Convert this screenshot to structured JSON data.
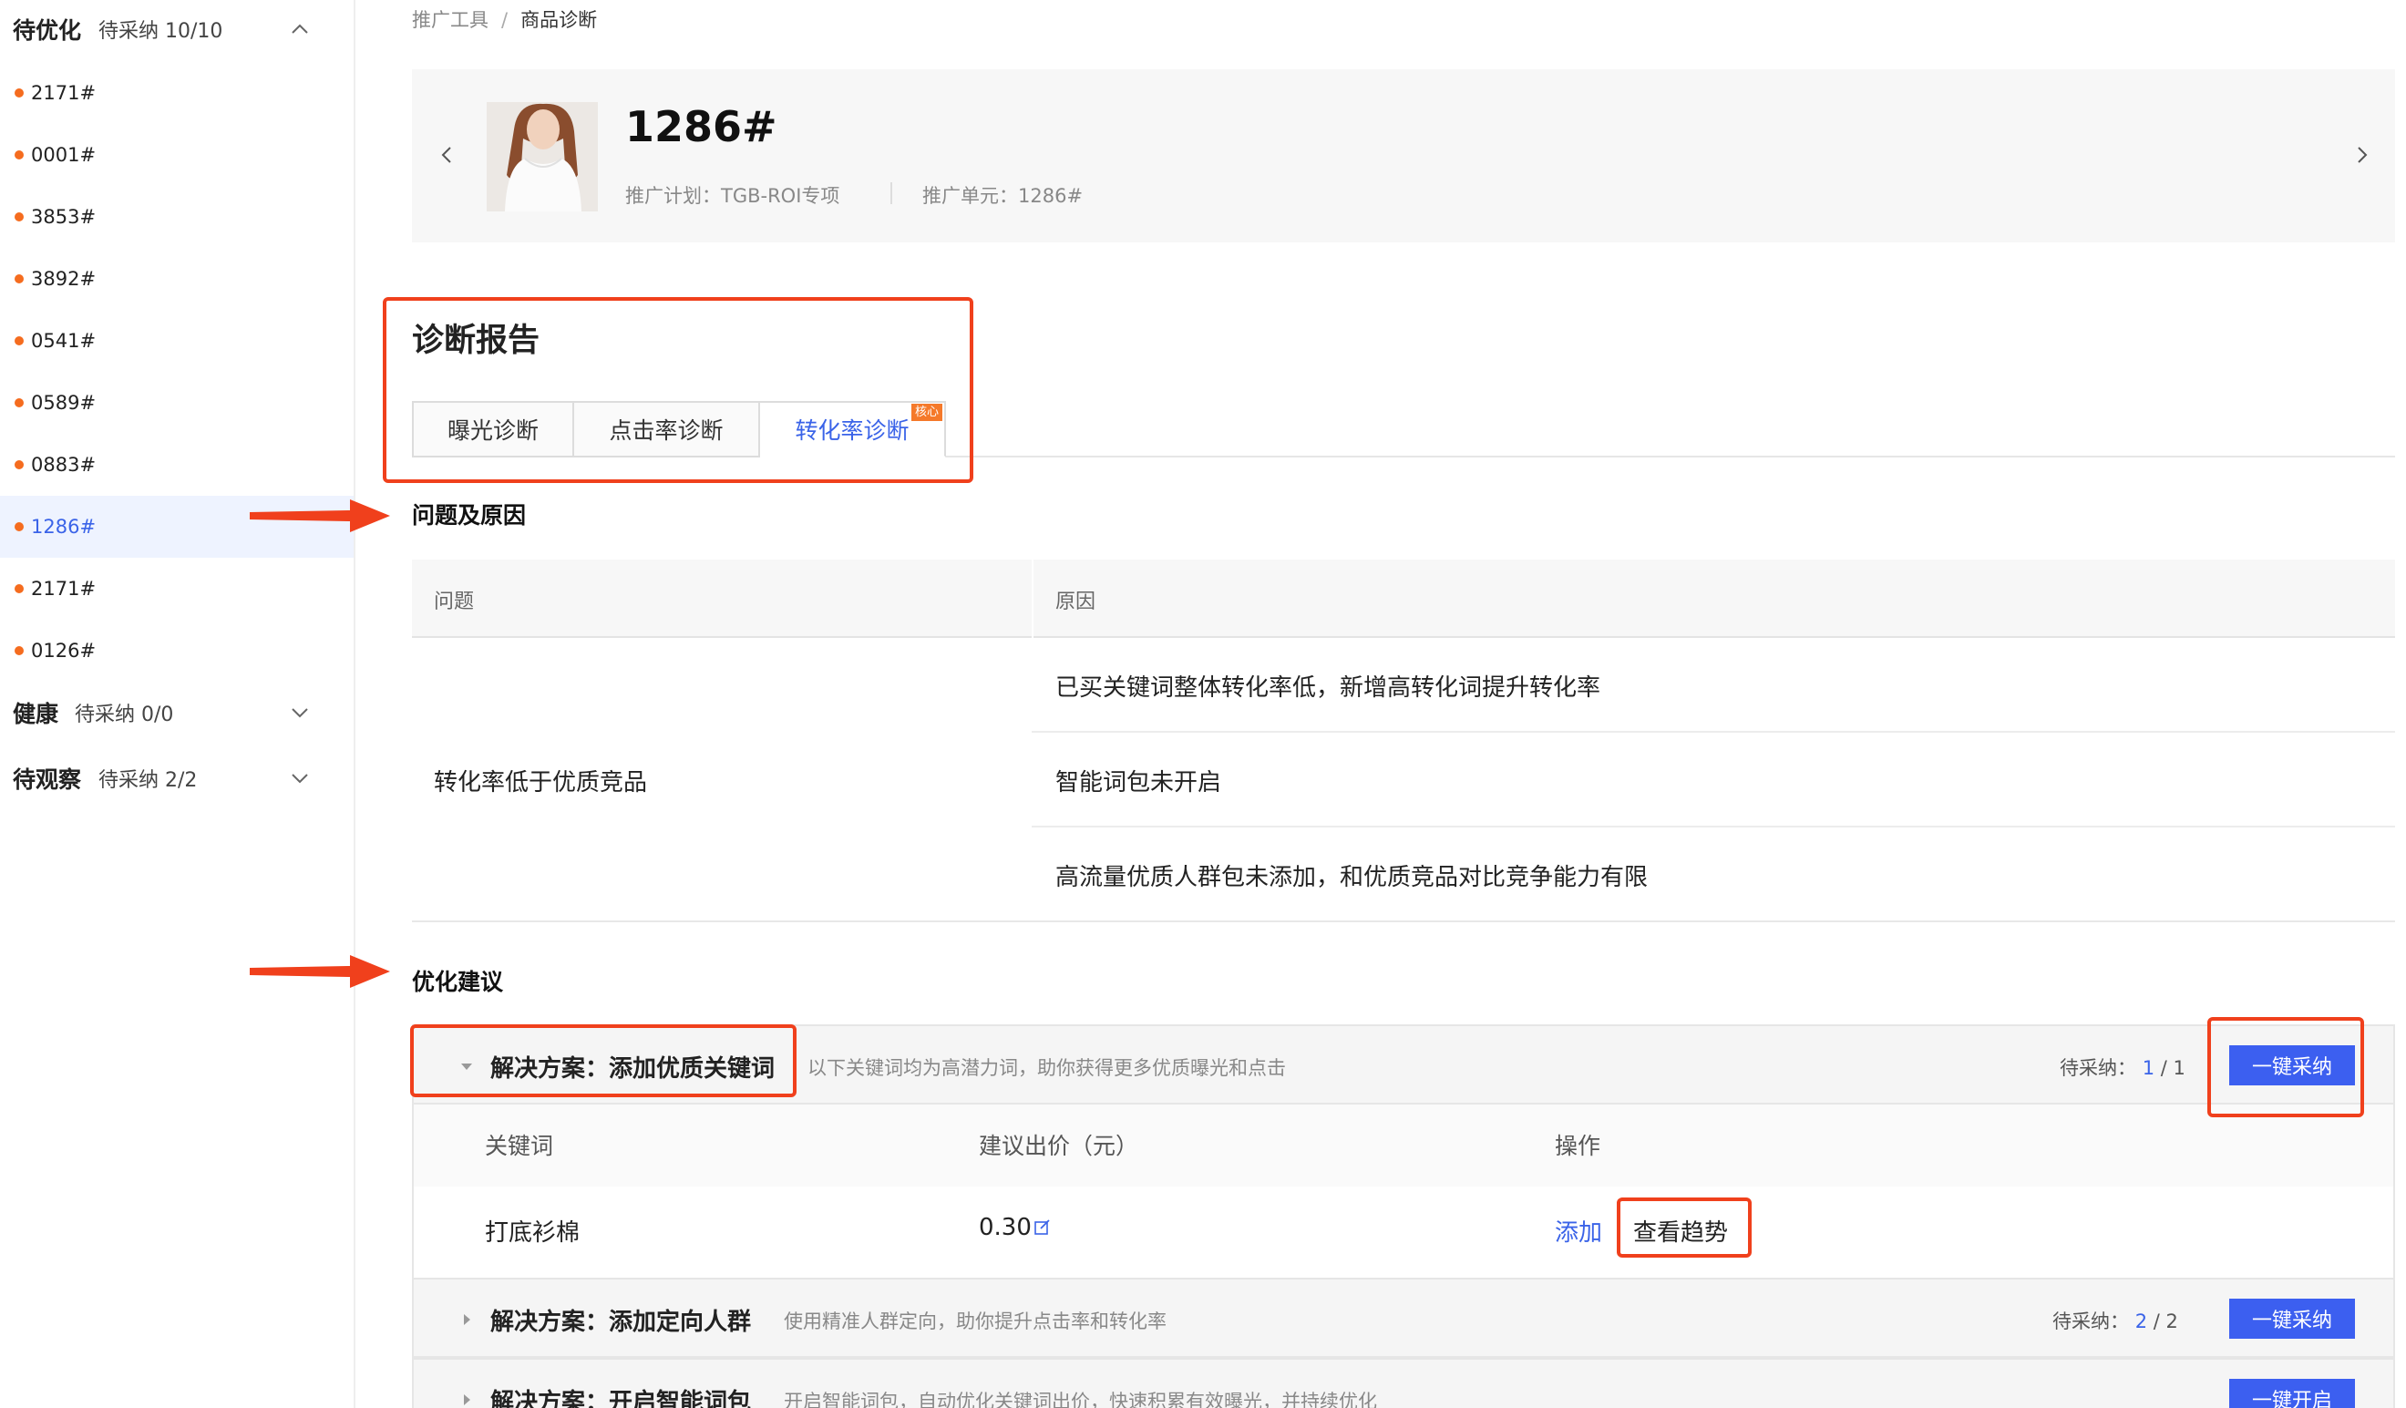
{
  "sidebar": {
    "groups": [
      {
        "title": "待优化",
        "count": "待采纳 10/10",
        "expanded": true
      },
      {
        "title": "健康",
        "count": "待采纳 0/0",
        "expanded": false
      },
      {
        "title": "待观察",
        "count": "待采纳 2/2",
        "expanded": false
      }
    ],
    "items": [
      "2171#",
      "0001#",
      "3853#",
      "3892#",
      "0541#",
      "0589#",
      "0883#",
      "1286#",
      "2171#",
      "0126#"
    ],
    "active_index": 7
  },
  "breadcrumb": {
    "parent": "推广工具",
    "separator": "/",
    "current": "商品诊断"
  },
  "product": {
    "title": "1286#",
    "plan": "推广计划：TGB-ROI专项",
    "unit": "推广单元：1286#"
  },
  "report": {
    "title": "诊断报告",
    "tabs": [
      {
        "label": "曝光诊断"
      },
      {
        "label": "点击率诊断"
      },
      {
        "label": "转化率诊断",
        "badge": "核心",
        "active": true
      }
    ]
  },
  "problems": {
    "title": "问题及原因",
    "col_problem": "问题",
    "col_reason": "原因",
    "problem": "转化率低于优质竞品",
    "reasons": [
      "已买关键词整体转化率低，新增高转化词提升转化率",
      "智能词包未开启",
      "高流量优质人群包未添加，和优质竞品对比竞争能力有限"
    ]
  },
  "suggestions": {
    "title": "优化建议",
    "solutions": [
      {
        "title": "解决方案：添加优质关键词",
        "desc": "以下关键词均为高潜力词，助你获得更多优质曝光和点击",
        "pending_label": "待采纳：",
        "pending_num": "1",
        "pending_total": "/ 1",
        "button": "一键采纳",
        "columns": [
          "关键词",
          "建议出价（元）",
          "操作"
        ],
        "rows": [
          {
            "keyword": "打底衫棉",
            "bid": "0.30",
            "action_add": "添加",
            "action_trend": "查看趋势"
          }
        ]
      },
      {
        "title": "解决方案：添加定向人群",
        "desc": "使用精准人群定向，助你提升点击率和转化率",
        "pending_label": "待采纳：",
        "pending_num": "2",
        "pending_total": "/ 2",
        "button": "一键采纳"
      },
      {
        "title": "解决方案：开启智能词包",
        "desc": "开启智能词包，自动优化关键词出价，快速积累有效曝光，并持续优化",
        "button": "一键开启"
      }
    ]
  },
  "colors": {
    "accent": "#3a63e8",
    "button": "#3c5ff0",
    "highlight": "#f0401c",
    "dot": "#f56c1f"
  }
}
